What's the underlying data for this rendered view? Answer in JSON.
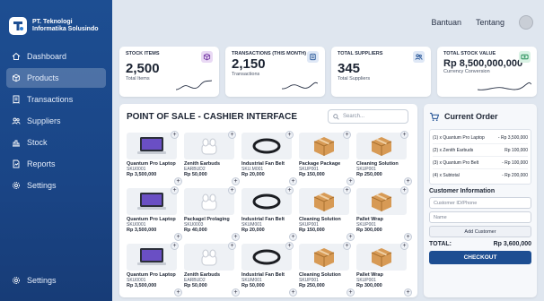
{
  "brand": {
    "line1": "PT. Teknologi",
    "line2": "Informatika Solusindo"
  },
  "sidebar": {
    "items": [
      {
        "label": "Dashboard",
        "icon": "home-icon"
      },
      {
        "label": "Products",
        "icon": "box-icon",
        "active": true
      },
      {
        "label": "Transactions",
        "icon": "receipt-icon"
      },
      {
        "label": "Suppliers",
        "icon": "users-icon"
      },
      {
        "label": "Stock",
        "icon": "stock-icon"
      },
      {
        "label": "Reports",
        "icon": "report-icon"
      },
      {
        "label": "Settings",
        "icon": "gear-icon"
      }
    ],
    "bottom_label": "Settings"
  },
  "topbar": {
    "help": "Bantuan",
    "about": "Tentang"
  },
  "stats": [
    {
      "title": "STOCK ITEMS",
      "value": "2,500",
      "sub": "Total Items",
      "icon": "cube-icon",
      "icon_color": "#e9d9f4"
    },
    {
      "title": "TRANSACTIONS (THIS MONTH)",
      "value": "2,150",
      "sub": "Transactions",
      "icon": "document-icon",
      "icon_color": "#dfe8f6"
    },
    {
      "title": "TOTAL SUPPLIERS",
      "value": "345",
      "sub": "Total Suppliers",
      "icon": "people-icon",
      "icon_color": "#dfe8f6"
    },
    {
      "title": "TOTAL STOCK VALUE",
      "value": "Rp 8,500,000,000",
      "sub": "Currency Conversion",
      "icon": "money-icon",
      "icon_color": "#d9f2e4"
    }
  ],
  "pos": {
    "title": "POINT OF SALE - CASHIER INTERFACE",
    "search_placeholder": "Search...",
    "products": [
      {
        "name": "Quantum Pro Laptop",
        "sku": "SKU0001",
        "price": "Rp 3,500,000",
        "kind": "laptop"
      },
      {
        "name": "Zenith Earbuds",
        "sku": "EARBUD2",
        "price": "Rp 50,000",
        "kind": "earbuds"
      },
      {
        "name": "Industrial Fan Belt",
        "sku": "SKU.M001",
        "price": "Rp 20,000",
        "kind": "belt"
      },
      {
        "name": "Package Package",
        "sku": "SKUP001",
        "price": "Rp 150,000",
        "kind": "box"
      },
      {
        "name": "Cleaning Solution",
        "sku": "SKUP001",
        "price": "Rp 250,000",
        "kind": "box"
      },
      {
        "name": "Quantum Pro Laptop",
        "sku": "SKU0001",
        "price": "Rp 3,500,000",
        "kind": "laptop"
      },
      {
        "name": "Packagel Prolaging",
        "sku": "SKU0003",
        "price": "Rp 40,000",
        "kind": "earbuds"
      },
      {
        "name": "Industrial Fan Belt",
        "sku": "SKUM001",
        "price": "Rp 20,000",
        "kind": "belt"
      },
      {
        "name": "Cleaning Solution",
        "sku": "SKUP001",
        "price": "Rp 150,000",
        "kind": "box"
      },
      {
        "name": "Pallet Wrap",
        "sku": "SKUP001",
        "price": "Rp 300,000",
        "kind": "box"
      },
      {
        "name": "Quantum Pro Laptop",
        "sku": "SKU0001",
        "price": "Rp 3,500,000",
        "kind": "laptop"
      },
      {
        "name": "Zenith Earbuds",
        "sku": "EARBUD2",
        "price": "Rp 50,000",
        "kind": "earbuds"
      },
      {
        "name": "Industrial Fan Belt",
        "sku": "SKUM001",
        "price": "Rp 50,000",
        "kind": "belt"
      },
      {
        "name": "Cleaning Solution",
        "sku": "SKUP001",
        "price": "Rp 250,000",
        "kind": "box"
      },
      {
        "name": "Pallet Wrap",
        "sku": "SKUP001",
        "price": "Rp 300,000",
        "kind": "box"
      }
    ]
  },
  "order": {
    "title": "Current Order",
    "lines": [
      {
        "item": "(1) x Quantum Pro Laptop",
        "price": "- Rp 3,500,000"
      },
      {
        "item": "(2) x Zenith Earbuds",
        "price": "Rp 100,000"
      },
      {
        "item": "(3) x Quantum Pro Belt",
        "price": "- Rp 100,000"
      },
      {
        "item": "(4) x Subtotal",
        "price": "- Rp 200,000"
      }
    ],
    "customer_title": "Customer Information",
    "customer_id_placeholder": "Customer ID/Phone",
    "name_placeholder": "Name",
    "add_customer": "Add Customer",
    "total_label": "TOTAL:",
    "total_value": "Rp 3,600,000",
    "checkout": "CHECKOUT"
  },
  "colors": {
    "sidebar": "#1d4e92",
    "accent": "#1d4e92"
  }
}
